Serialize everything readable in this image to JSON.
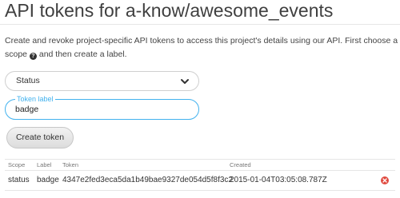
{
  "page_title": "API tokens for a-know/awesome_events",
  "description": {
    "text_before": "Create and revoke project-specific API tokens to access this project's details using our API. First choose a scope ",
    "text_after": " and then create a label.",
    "help_icon": "question-circle-icon"
  },
  "scope_select": {
    "value": "Status",
    "icon": "chevron-down-icon"
  },
  "token_label_field": {
    "label": "Token label",
    "value": "badge"
  },
  "create_button": {
    "label": "Create token"
  },
  "tokens_table": {
    "headers": {
      "scope": "Scope",
      "label": "Label",
      "token": "Token",
      "created": "Created"
    },
    "rows": [
      {
        "scope": "status",
        "label": "badge",
        "token": "4347e2fed3eca5da1b49bae9327de054d5f8f3c2",
        "created": "2015-01-04T03:05:08.787Z",
        "delete_icon": "remove-circle-icon"
      }
    ]
  },
  "colors": {
    "accent": "#42b2ee",
    "danger": "#e04a3f",
    "title": "#3f3f3f"
  }
}
